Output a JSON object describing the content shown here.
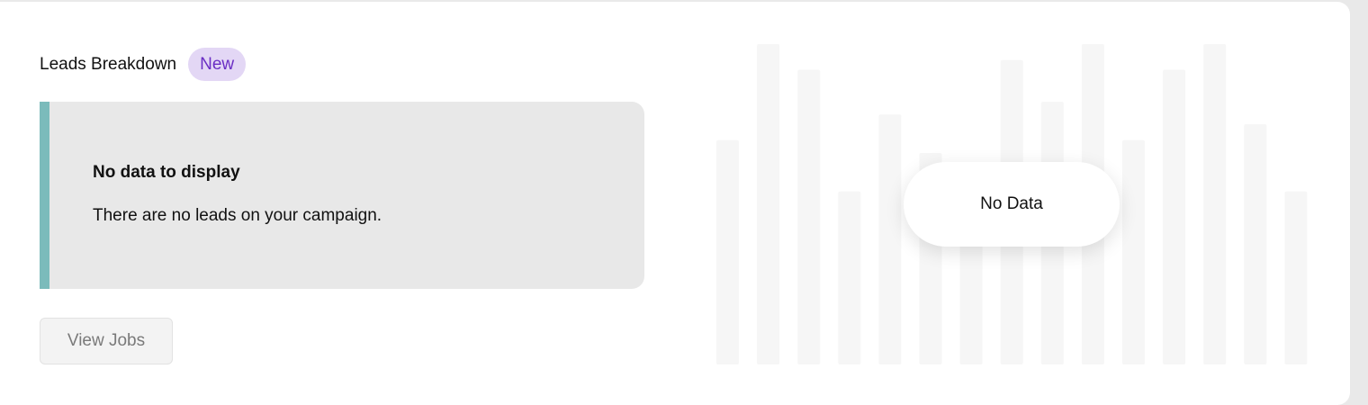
{
  "header": {
    "title": "Leads Breakdown",
    "badge": "New"
  },
  "empty_state": {
    "heading": "No data to display",
    "message": "There are no leads on your campaign."
  },
  "actions": {
    "view_jobs_label": "View Jobs"
  },
  "placeholder_chart": {
    "overlay_label": "No Data",
    "bar_heights": [
      0.7,
      1.0,
      0.92,
      0.54,
      0.78,
      0.66,
      0.6,
      0.95,
      0.82,
      1.0,
      0.7,
      0.92,
      1.0,
      0.75,
      0.54
    ]
  },
  "colors": {
    "accent_bar": "#7bbbbb",
    "badge_bg": "#e3d7f5",
    "badge_text": "#6a2ec4",
    "placeholder_bars": "#f6f6f6"
  }
}
